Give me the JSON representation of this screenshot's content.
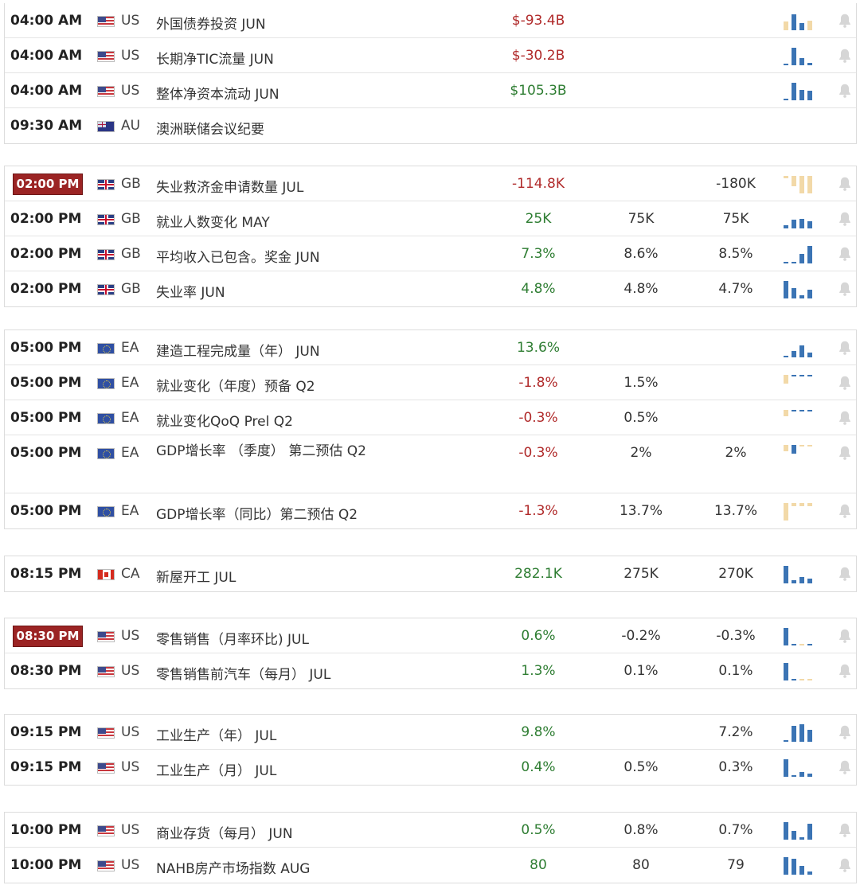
{
  "colors": {
    "highlight": "#9b2424",
    "positive": "#2e7d32",
    "negative": "#b02a2a",
    "bar_blue": "#3b74b4",
    "bar_tan": "#f2d9a8",
    "bell": "#d6d6d6"
  },
  "icons": {
    "alert": "bell-icon",
    "history": "sparkline-icon"
  },
  "groups": [
    {
      "rows": [
        {
          "time": "04:00 AM",
          "highlight": false,
          "flag": "us",
          "currency": "US",
          "event": "外国债券投资 JUN",
          "actual": "$-93.4B",
          "actual_tone": "neg",
          "forecast": "",
          "previous": "",
          "spark_color": "blue",
          "spark": [
            {
              "v": 0.5,
              "c": "tan"
            },
            {
              "v": 0.9,
              "c": "blue"
            },
            {
              "v": 0.4,
              "c": "blue"
            },
            {
              "v": 0.55,
              "c": "tan"
            }
          ]
        },
        {
          "time": "04:00 AM",
          "highlight": false,
          "flag": "us",
          "currency": "US",
          "event": "长期净TIC流量 JUN",
          "actual": "$-30.2B",
          "actual_tone": "neg",
          "forecast": "",
          "previous": "",
          "spark": [
            {
              "v": 0.1,
              "c": "blue"
            },
            {
              "v": 1.0,
              "c": "blue"
            },
            {
              "v": 0.4,
              "c": "blue"
            },
            {
              "v": 0.15,
              "c": "blue"
            }
          ]
        },
        {
          "time": "04:00 AM",
          "highlight": false,
          "flag": "us",
          "currency": "US",
          "event": "整体净资本流动 JUN",
          "actual": "$105.3B",
          "actual_tone": "pos",
          "forecast": "",
          "previous": "",
          "spark": [
            {
              "v": 0.1,
              "c": "blue"
            },
            {
              "v": 1.0,
              "c": "blue"
            },
            {
              "v": 0.6,
              "c": "blue"
            },
            {
              "v": 0.55,
              "c": "blue"
            }
          ]
        },
        {
          "time": "09:30 AM",
          "highlight": false,
          "flag": "au",
          "currency": "AU",
          "event": "澳洲联储会议纪要",
          "actual": "",
          "actual_tone": "",
          "forecast": "",
          "previous": "",
          "spark": [],
          "no_bell": true
        }
      ]
    },
    {
      "rows": [
        {
          "time": "02:00 PM",
          "highlight": true,
          "flag": "gb",
          "currency": "GB",
          "event": "失业救济金申请数量 JUL",
          "actual": "-114.8K",
          "actual_tone": "neg",
          "forecast": "",
          "previous": "-180K",
          "spark": [
            {
              "v": 0.15,
              "c": "tan"
            },
            {
              "v": 0.6,
              "c": "tan"
            },
            {
              "v": 1.0,
              "c": "tan"
            },
            {
              "v": 1.0,
              "c": "tan"
            }
          ],
          "top_anchor": true
        },
        {
          "time": "02:00 PM",
          "highlight": false,
          "flag": "gb",
          "currency": "GB",
          "event": "就业人数变化 MAY",
          "actual": "25K",
          "actual_tone": "pos",
          "forecast": "75K",
          "previous": "75K",
          "spark": [
            {
              "v": 0.2,
              "c": "blue"
            },
            {
              "v": 0.5,
              "c": "blue"
            },
            {
              "v": 0.55,
              "c": "blue"
            },
            {
              "v": 0.4,
              "c": "blue"
            }
          ]
        },
        {
          "time": "02:00 PM",
          "highlight": false,
          "flag": "gb",
          "currency": "GB",
          "event": "平均收入已包含。奖金 JUN",
          "actual": "7.3%",
          "actual_tone": "pos",
          "forecast": "8.6%",
          "previous": "8.5%",
          "spark": [
            {
              "v": 0.08,
              "c": "blue"
            },
            {
              "v": 0.1,
              "c": "blue"
            },
            {
              "v": 0.55,
              "c": "blue"
            },
            {
              "v": 1.0,
              "c": "blue"
            }
          ]
        },
        {
          "time": "02:00 PM",
          "highlight": false,
          "flag": "gb",
          "currency": "GB",
          "event": "失业率 JUN",
          "actual": "4.8%",
          "actual_tone": "pos",
          "forecast": "4.8%",
          "previous": "4.7%",
          "spark": [
            {
              "v": 1.0,
              "c": "blue"
            },
            {
              "v": 0.6,
              "c": "blue"
            },
            {
              "v": 0.2,
              "c": "blue"
            },
            {
              "v": 0.5,
              "c": "blue"
            }
          ]
        }
      ]
    },
    {
      "rows": [
        {
          "time": "05:00 PM",
          "highlight": false,
          "flag": "eu",
          "currency": "EA",
          "event": "建造工程完成量（年） JUN",
          "actual": "13.6%",
          "actual_tone": "pos",
          "forecast": "",
          "previous": "",
          "spark": [
            {
              "v": 0.1,
              "c": "blue"
            },
            {
              "v": 0.35,
              "c": "blue"
            },
            {
              "v": 0.7,
              "c": "blue"
            },
            {
              "v": 0.25,
              "c": "blue"
            }
          ]
        },
        {
          "time": "05:00 PM",
          "highlight": false,
          "flag": "eu",
          "currency": "EA",
          "event": "就业变化（年度）预备 Q2",
          "actual": "-1.8%",
          "actual_tone": "neg",
          "forecast": "1.5%",
          "previous": "",
          "spark": [
            {
              "v": 0.5,
              "c": "tan"
            },
            {
              "v": 0.1,
              "c": "blue"
            },
            {
              "v": 0.1,
              "c": "blue"
            },
            {
              "v": 0.1,
              "c": "blue"
            }
          ],
          "top_anchor": true
        },
        {
          "time": "05:00 PM",
          "highlight": false,
          "flag": "eu",
          "currency": "EA",
          "event": "就业变化QoQ Prel Q2",
          "actual": "-0.3%",
          "actual_tone": "neg",
          "forecast": "0.5%",
          "previous": "",
          "spark": [
            {
              "v": 0.35,
              "c": "tan"
            },
            {
              "v": 0.1,
              "c": "blue"
            },
            {
              "v": 0.1,
              "c": "blue"
            },
            {
              "v": 0.1,
              "c": "blue"
            }
          ],
          "top_anchor": true
        },
        {
          "time": "05:00 PM",
          "highlight": false,
          "tall": true,
          "flag": "eu",
          "currency": "EA",
          "event": "GDP增长率 （季度） 第二预估 Q2",
          "actual": "-0.3%",
          "actual_tone": "neg",
          "forecast": "2%",
          "previous": "2%",
          "spark": [
            {
              "v": 0.35,
              "c": "tan"
            },
            {
              "v": 0.5,
              "c": "blue"
            },
            {
              "v": 0.1,
              "c": "tan"
            },
            {
              "v": 0.1,
              "c": "tan"
            }
          ],
          "top_anchor": true
        },
        {
          "time": "05:00 PM",
          "highlight": false,
          "flag": "eu",
          "currency": "EA",
          "event": "GDP增长率（同比）第二预估 Q2",
          "actual": "-1.3%",
          "actual_tone": "neg",
          "forecast": "13.7%",
          "previous": "13.7%",
          "spark": [
            {
              "v": 1.0,
              "c": "tan"
            },
            {
              "v": 0.2,
              "c": "tan"
            },
            {
              "v": 0.2,
              "c": "tan"
            },
            {
              "v": 0.2,
              "c": "tan"
            }
          ],
          "top_anchor": true
        }
      ]
    },
    {
      "rows": [
        {
          "time": "08:15 PM",
          "highlight": false,
          "flag": "ca",
          "currency": "CA",
          "event": "新屋开工 JUL",
          "actual": "282.1K",
          "actual_tone": "pos",
          "forecast": "275K",
          "previous": "270K",
          "spark": [
            {
              "v": 1.0,
              "c": "blue"
            },
            {
              "v": 0.2,
              "c": "blue"
            },
            {
              "v": 0.35,
              "c": "blue"
            },
            {
              "v": 0.25,
              "c": "blue"
            }
          ]
        }
      ]
    },
    {
      "rows": [
        {
          "time": "08:30 PM",
          "highlight": true,
          "flag": "us",
          "currency": "US",
          "event": "零售销售（月率环比) JUL",
          "actual": "0.6%",
          "actual_tone": "pos",
          "forecast": "-0.2%",
          "previous": "-0.3%",
          "spark": [
            {
              "v": 1.0,
              "c": "blue"
            },
            {
              "v": 0.08,
              "c": "blue"
            },
            {
              "v": 0.08,
              "c": "tan"
            },
            {
              "v": 0.08,
              "c": "blue"
            }
          ]
        },
        {
          "time": "08:30 PM",
          "highlight": false,
          "flag": "us",
          "currency": "US",
          "event": "零售销售前汽车（每月） JUL",
          "actual": "1.3%",
          "actual_tone": "pos",
          "forecast": "0.1%",
          "previous": "0.1%",
          "spark": [
            {
              "v": 1.0,
              "c": "blue"
            },
            {
              "v": 0.08,
              "c": "blue"
            },
            {
              "v": 0.08,
              "c": "tan"
            },
            {
              "v": 0.08,
              "c": "tan"
            }
          ]
        }
      ]
    },
    {
      "rows": [
        {
          "time": "09:15 PM",
          "highlight": false,
          "flag": "us",
          "currency": "US",
          "event": "工业生产（年） JUL",
          "actual": "9.8%",
          "actual_tone": "pos",
          "forecast": "",
          "previous": "7.2%",
          "spark": [
            {
              "v": 0.1,
              "c": "blue"
            },
            {
              "v": 0.9,
              "c": "blue"
            },
            {
              "v": 1.0,
              "c": "blue"
            },
            {
              "v": 0.7,
              "c": "blue"
            }
          ]
        },
        {
          "time": "09:15 PM",
          "highlight": false,
          "flag": "us",
          "currency": "US",
          "event": "工业生产（月） JUL",
          "actual": "0.4%",
          "actual_tone": "pos",
          "forecast": "0.5%",
          "previous": "0.3%",
          "spark": [
            {
              "v": 1.0,
              "c": "blue"
            },
            {
              "v": 0.1,
              "c": "blue"
            },
            {
              "v": 0.25,
              "c": "blue"
            },
            {
              "v": 0.2,
              "c": "blue"
            }
          ]
        }
      ]
    },
    {
      "rows": [
        {
          "time": "10:00 PM",
          "highlight": false,
          "flag": "us",
          "currency": "US",
          "event": "商业存货（每月） JUN",
          "actual": "0.5%",
          "actual_tone": "pos",
          "forecast": "0.8%",
          "previous": "0.7%",
          "spark": [
            {
              "v": 1.0,
              "c": "blue"
            },
            {
              "v": 0.5,
              "c": "blue"
            },
            {
              "v": 0.15,
              "c": "blue"
            },
            {
              "v": 0.9,
              "c": "blue"
            }
          ]
        },
        {
          "time": "10:00 PM",
          "highlight": false,
          "flag": "us",
          "currency": "US",
          "event": "NAHB房产市场指数 AUG",
          "actual": "80",
          "actual_tone": "pos",
          "forecast": "80",
          "previous": "79",
          "spark": [
            {
              "v": 1.0,
              "c": "blue"
            },
            {
              "v": 0.9,
              "c": "blue"
            },
            {
              "v": 0.5,
              "c": "blue"
            },
            {
              "v": 0.2,
              "c": "blue"
            }
          ]
        }
      ]
    }
  ]
}
